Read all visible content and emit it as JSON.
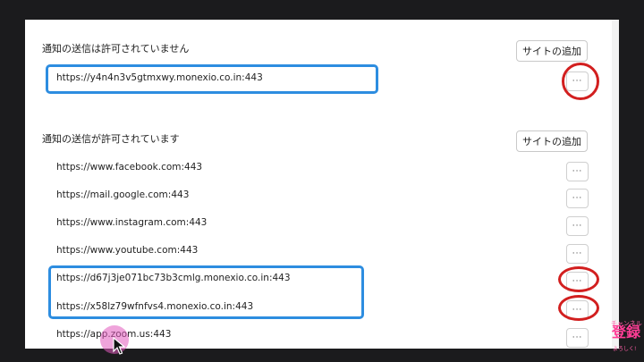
{
  "blocked": {
    "title": "通知の送信は許可されていません",
    "add_label": "サイトの追加",
    "sites": [
      "https://y4n4n3v5gtmxwy.monexio.co.in:443"
    ]
  },
  "allowed": {
    "title": "通知の送信が許可されています",
    "add_label": "サイトの追加",
    "sites": [
      "https://www.facebook.com:443",
      "https://mail.google.com:443",
      "https://www.instagram.com:443",
      "https://www.youtube.com:443",
      "https://d67j3je071bc73b3cmlg.monexio.co.in:443",
      "https://x58lz79wfnfvs4.monexio.co.in:443",
      "https://app.zoom.us:443"
    ]
  },
  "more_label": "···",
  "logo": {
    "top": "チャンネル",
    "main": "登録",
    "sub": "よろしく!"
  },
  "colors": {
    "highlight_box": "#2d8de0",
    "highlight_ring": "#d21f1f",
    "cursor_halo": "#e15abe"
  }
}
